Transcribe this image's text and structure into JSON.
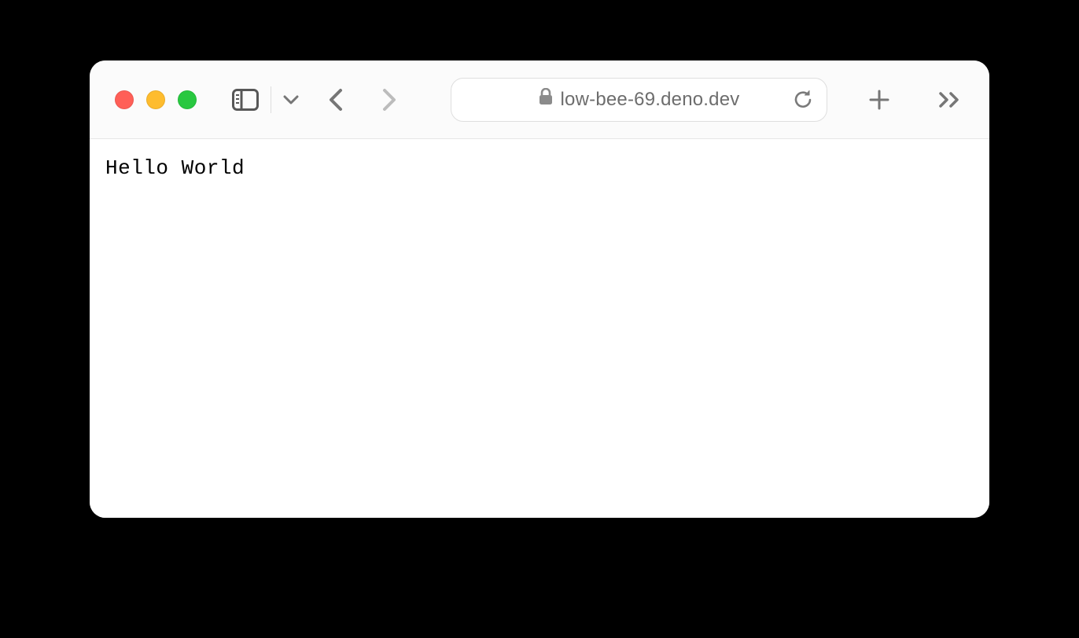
{
  "browser": {
    "address": "low-bee-69.deno.dev"
  },
  "page": {
    "body_text": "Hello World"
  }
}
